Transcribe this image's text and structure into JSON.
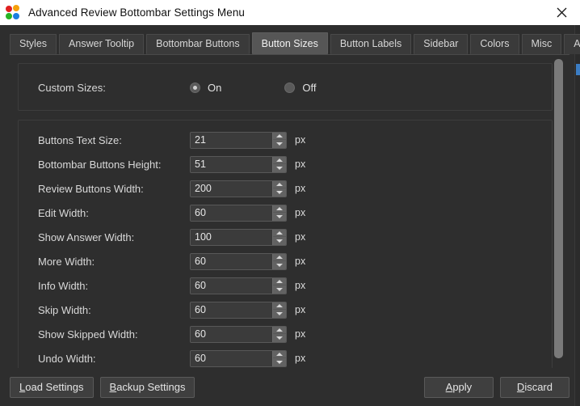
{
  "window": {
    "title": "Advanced Review Bottombar Settings Menu",
    "close_label": "×",
    "icon_name": "anki-dots-icon"
  },
  "tabs": [
    {
      "label": "Styles",
      "active": false
    },
    {
      "label": "Answer Tooltip",
      "active": false
    },
    {
      "label": "Bottombar Buttons",
      "active": false
    },
    {
      "label": "Button Sizes",
      "active": true
    },
    {
      "label": "Button Labels",
      "active": false
    },
    {
      "label": "Sidebar",
      "active": false
    },
    {
      "label": "Colors",
      "active": false
    },
    {
      "label": "Misc",
      "active": false
    },
    {
      "label": "About",
      "active": false
    }
  ],
  "custom_sizes": {
    "label": "Custom Sizes:",
    "options": [
      {
        "label": "On",
        "selected": true
      },
      {
        "label": "Off",
        "selected": false
      }
    ]
  },
  "size_rows": [
    {
      "label": "Buttons Text Size:",
      "value": "21",
      "unit": "px"
    },
    {
      "label": "Bottombar Buttons Height:",
      "value": "51",
      "unit": "px"
    },
    {
      "label": "Review Buttons Width:",
      "value": "200",
      "unit": "px"
    },
    {
      "label": "Edit Width:",
      "value": "60",
      "unit": "px"
    },
    {
      "label": "Show Answer Width:",
      "value": "100",
      "unit": "px"
    },
    {
      "label": "More Width:",
      "value": "60",
      "unit": "px"
    },
    {
      "label": "Info Width:",
      "value": "60",
      "unit": "px"
    },
    {
      "label": "Skip Width:",
      "value": "60",
      "unit": "px"
    },
    {
      "label": "Show Skipped Width:",
      "value": "60",
      "unit": "px"
    },
    {
      "label": "Undo Width:",
      "value": "60",
      "unit": "px"
    }
  ],
  "footer": {
    "load_settings": {
      "mnemonic": "L",
      "rest": "oad Settings"
    },
    "backup_settings": {
      "mnemonic": "B",
      "rest": "ackup Settings"
    },
    "apply": {
      "mnemonic": "A",
      "rest": "pply"
    },
    "discard": {
      "mnemonic": "D",
      "rest": "iscard"
    }
  },
  "colors": {
    "titlebar_bg": "#ffffff",
    "window_bg": "#2e2e2e",
    "tab_active_bg": "#565656",
    "accent_scrollbar": "#3b7dc4",
    "icon_red": "#e02020",
    "icon_orange": "#f5a00a",
    "icon_green": "#27b324",
    "icon_blue": "#1b7fe0"
  }
}
